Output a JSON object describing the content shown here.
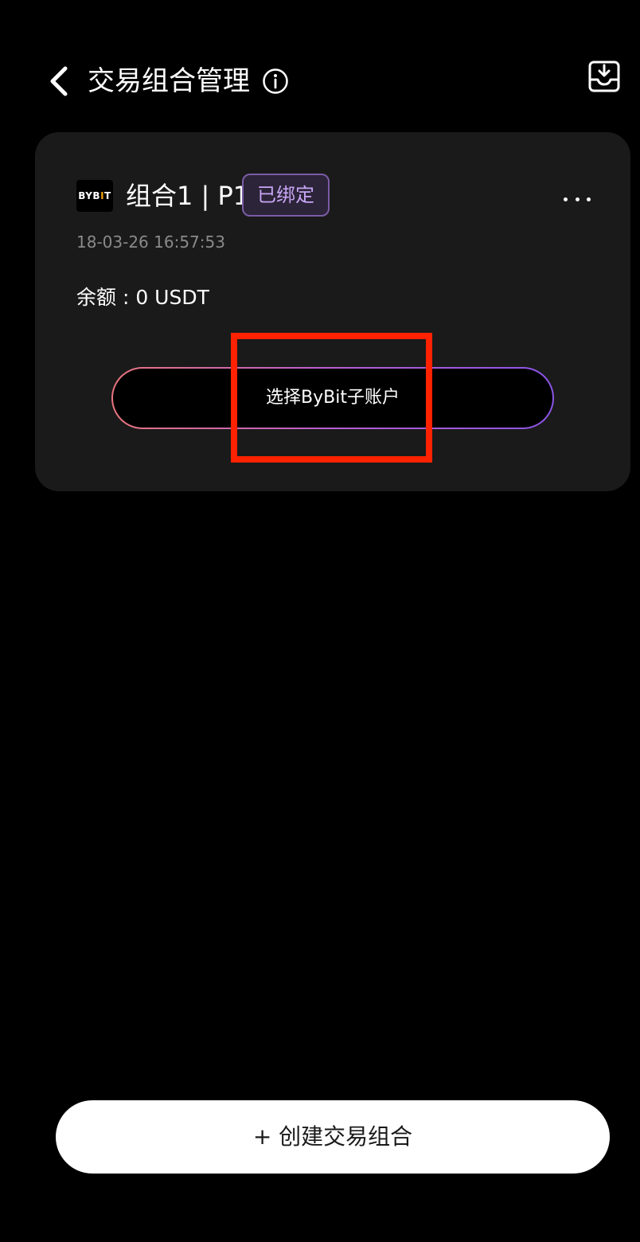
{
  "header": {
    "title": "交易组合管理",
    "back_icon": "chevron-left-icon",
    "info_icon": "info-circle-icon",
    "export_icon": "tray-download-icon"
  },
  "portfolio_card": {
    "exchange_logo": {
      "prefix": "BYB",
      "accent": "I",
      "suffix": "T"
    },
    "name": "组合1 | P1",
    "status_badge": "已绑定",
    "timestamp": "18-03-26 16:57:53",
    "balance": "余额 : 0 USDT",
    "select_sub_account_label": "选择ByBit子账户",
    "more_icon": "more-dots-icon"
  },
  "create_button": {
    "label": "+ 创建交易组合"
  },
  "colors": {
    "background": "#000000",
    "card": "#1a1a1a",
    "badge_text": "#c7a6f5",
    "badge_border": "#7b5ca6",
    "gradient_start": "#e8747c",
    "gradient_end": "#8b54e6",
    "highlight": "#ff2200"
  }
}
